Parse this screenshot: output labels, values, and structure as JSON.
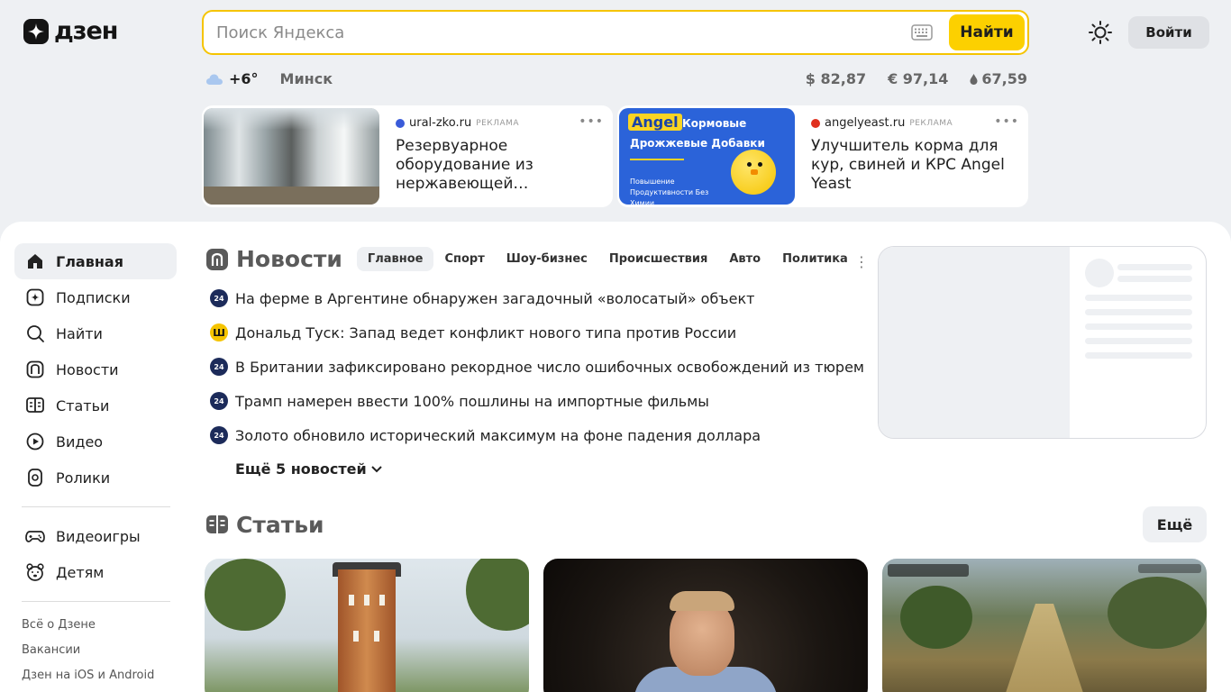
{
  "header": {
    "logo_text": "дзен",
    "search_placeholder": "Поиск Яндекса",
    "search_button": "Найти",
    "login_button": "Войти"
  },
  "info": {
    "temperature": "+6°",
    "city": "Минск",
    "rates": [
      {
        "label": "$ 82,87"
      },
      {
        "label": "€ 97,14"
      },
      {
        "label": "67,59"
      }
    ]
  },
  "ads": [
    {
      "domain": "ural-zko.ru",
      "tag": "РЕКЛАМА",
      "title": "Резервуарное оборудование из нержавеющей…"
    },
    {
      "domain": "angelyeast.ru",
      "tag": "РЕКЛАМА",
      "title": "Улучшитель корма для кур, свиней и КРС Angel Yeast",
      "banner_badge": "Angel",
      "banner_title1": "Кормовые",
      "banner_title2": "Дрожжевые Добавки",
      "banner_sub": "Повышение Продуктивности Без Химии"
    }
  ],
  "sidebar": {
    "items": [
      {
        "label": "Главная",
        "icon": "home-icon"
      },
      {
        "label": "Подписки",
        "icon": "subscriptions-icon"
      },
      {
        "label": "Найти",
        "icon": "search-icon"
      },
      {
        "label": "Новости",
        "icon": "news-icon"
      },
      {
        "label": "Статьи",
        "icon": "articles-icon"
      },
      {
        "label": "Видео",
        "icon": "video-icon"
      },
      {
        "label": "Ролики",
        "icon": "shorts-icon"
      }
    ],
    "items2": [
      {
        "label": "Видеоигры",
        "icon": "gamepad-icon"
      },
      {
        "label": "Детям",
        "icon": "kids-icon"
      }
    ],
    "footer": [
      "Всё о Дзене",
      "Вакансии",
      "Дзен на iOS и Android"
    ]
  },
  "news": {
    "title": "Новости",
    "tabs": [
      "Главное",
      "Спорт",
      "Шоу-бизнес",
      "Происшествия",
      "Авто",
      "Политика"
    ],
    "items": [
      {
        "source": "24",
        "text": "На ферме в Аргентине обнаружен загадочный «волосатый» объект"
      },
      {
        "source": "Ш",
        "text": "Дональд Туск: Запад ведет конфликт нового типа против России"
      },
      {
        "source": "24",
        "text": "В Британии зафиксировано рекордное число ошибочных освобождений из тюрем"
      },
      {
        "source": "24",
        "text": "Трамп намерен ввести 100% пошлины на импортные фильмы"
      },
      {
        "source": "24",
        "text": "Золото обновило исторический максимум на фоне падения доллара"
      }
    ],
    "more": "Ещё 5 новостей"
  },
  "articles": {
    "title": "Статьи",
    "more_button": "Ещё"
  },
  "colors": {
    "accent": "#fcd000",
    "background": "#eef0f3"
  }
}
